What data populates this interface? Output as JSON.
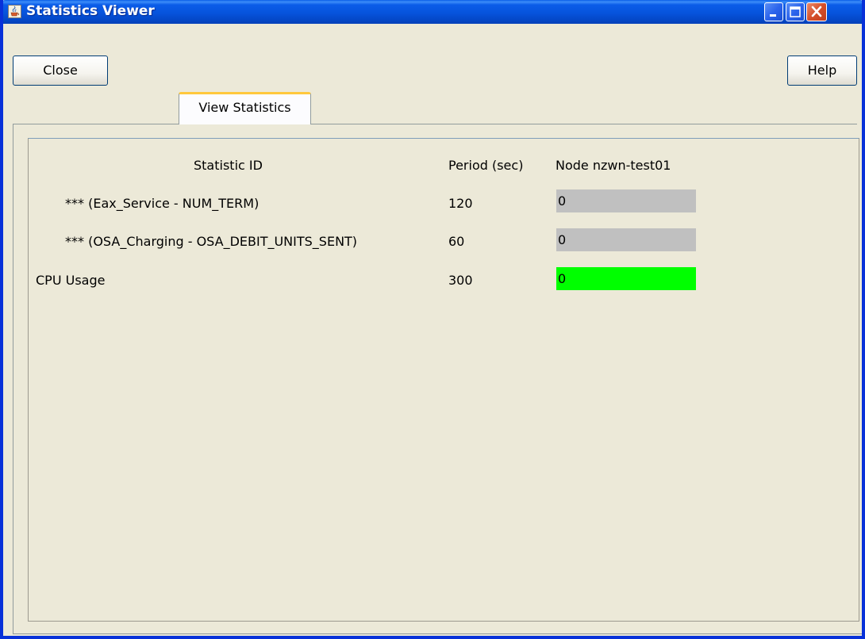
{
  "window": {
    "title": "Statistics Viewer",
    "app_icon": "java-cup-icon"
  },
  "toolbar": {
    "close_label": "Close",
    "help_label": "Help"
  },
  "tabs": [
    {
      "label": "View Statistics",
      "selected": true
    }
  ],
  "table": {
    "headers": {
      "statistic_id": "Statistic ID",
      "period": "Period (sec)",
      "node": "Node nzwn-test01"
    },
    "rows": [
      {
        "statistic_id": "*** (Eax_Service - NUM_TERM)",
        "period": "120",
        "value": "0",
        "status_color": "#C0C0C0"
      },
      {
        "statistic_id": "*** (OSA_Charging - OSA_DEBIT_UNITS_SENT)",
        "period": "60",
        "value": "0",
        "status_color": "#C0C0C0"
      },
      {
        "statistic_id": "CPU Usage",
        "period": "300",
        "value": "0",
        "status_color": "#00FF00"
      }
    ]
  },
  "colors": {
    "titlebar": "#0653DC",
    "window_bg": "#ECE9D8",
    "tab_accent": "#FFC83C"
  }
}
